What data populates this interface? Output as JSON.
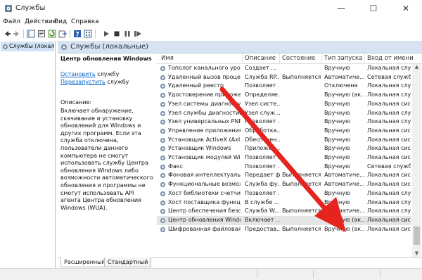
{
  "window": {
    "title": "Службы",
    "controls": {
      "minimize": "—",
      "maximize": "☐",
      "close": "✕"
    }
  },
  "menu": [
    "Файл",
    "Действие",
    "Вид",
    "Справка"
  ],
  "toolbar": {
    "buttons": [
      "back-icon",
      "forward-icon",
      "console-tree-icon",
      "properties-icon",
      "refresh-icon",
      "export-icon",
      "help-icon",
      "view-icon",
      "start-icon",
      "stop-icon",
      "pause-icon",
      "restart-icon"
    ]
  },
  "tree": {
    "item": "Службы (локальные)"
  },
  "header": {
    "title": "Службы (локальные)"
  },
  "description": {
    "service_name": "Центр обновления Windows",
    "link1": "Остановить",
    "link1_suffix": " службу",
    "link2": "Перезапустить",
    "link2_suffix": " службу",
    "label": "Описание:",
    "text": "Включает обнаружение, скачивание и установку обновлений для Windows и других программ. Если эта служба отключена, пользователи данного компьютера не смогут использовать службу Центра обновления Windows либо возможности автоматического обновления и программы не смогут использовать API агента Центра обновления Windows (WUA)."
  },
  "table": {
    "columns": [
      "Имя",
      "Описание",
      "Состояние",
      "Тип запуска",
      "Вход от имени"
    ],
    "rows": [
      {
        "name": "Тополог канального уровня",
        "desc": "Создает ...",
        "status": "",
        "start": "Вручную",
        "logon": "Локальная слу..."
      },
      {
        "name": "Удаленный вызов процедур...",
        "desc": "Служба RP...",
        "status": "Выполняется",
        "start": "Автоматиче...",
        "logon": "Сетевая служба"
      },
      {
        "name": "Удаленный реестр",
        "desc": "Позволяет ...",
        "status": "",
        "start": "Отключена",
        "logon": "Локальная слу..."
      },
      {
        "name": "Удостоверение приложения",
        "desc": "Определяе...",
        "status": "",
        "start": "Вручную (ак...",
        "logon": "Локальная слу..."
      },
      {
        "name": "Узел системы диагностики",
        "desc": "Узел систе...",
        "status": "",
        "start": "Вручную",
        "logon": "Локальная сист..."
      },
      {
        "name": "Узел службы диагностики",
        "desc": "Узел служ...",
        "status": "",
        "start": "Вручную",
        "logon": "Локальная слу..."
      },
      {
        "name": "Узел универсальных PNP-у...",
        "desc": "Позволяет ...",
        "status": "",
        "start": "Вручную",
        "logon": "Локальная слу..."
      },
      {
        "name": "Управление приложениями",
        "desc": "Обработка...",
        "status": "",
        "start": "Вручную",
        "logon": "Локальная сист..."
      },
      {
        "name": "Установщик ActiveX (AxInst...",
        "desc": "Обеспечен...",
        "status": "",
        "start": "Вручную",
        "logon": "Локальная сист..."
      },
      {
        "name": "Установщик Windows",
        "desc": "Приложен...",
        "status": "",
        "start": "Вручную",
        "logon": "Локальная сист..."
      },
      {
        "name": "Установщик модулей Windo...",
        "desc": "Позволяет ...",
        "status": "",
        "start": "Вручную",
        "logon": "Локальная сист..."
      },
      {
        "name": "Факс",
        "desc": "Позволяет ...",
        "status": "",
        "start": "Вручную",
        "logon": "Сетевая служба"
      },
      {
        "name": "Фоновая интеллектуальна...",
        "desc": "Передает ф...",
        "status": "Выполняется",
        "start": "Автоматиче...",
        "logon": "Локальная сист..."
      },
      {
        "name": "Функциональные возможн...",
        "desc": "Служба фу...",
        "status": "Выполняется",
        "start": "Автоматиче...",
        "logon": "Локальная сист..."
      },
      {
        "name": "Хост библиотеки счетчика...",
        "desc": "Позволяет ...",
        "status": "",
        "start": "Вручную",
        "logon": "Локальная слу..."
      },
      {
        "name": "Хост поставщика функции ...",
        "desc": "В службе ...",
        "status": "",
        "start": "Вручную",
        "logon": "Локальная слу..."
      },
      {
        "name": "Центр обеспечения безоп...",
        "desc": "Служба W...",
        "status": "Выполняется",
        "start": "Автоматиче...",
        "logon": "Локальная слу..."
      },
      {
        "name": "Центр обновления Windows",
        "desc": "Включает ...",
        "status": "",
        "start": "Вручную (ак...",
        "logon": "Локальная сист..."
      },
      {
        "name": "Шифрованная файловая сис...",
        "desc": "Предостав...",
        "status": "Выполняется",
        "start": "Вручную (ак...",
        "logon": "Локальная сист..."
      }
    ],
    "selected_index": 17
  },
  "tabs": [
    "Расширенный",
    "Стандартный"
  ],
  "overlay": {
    "arrow_color": "#e52420"
  }
}
